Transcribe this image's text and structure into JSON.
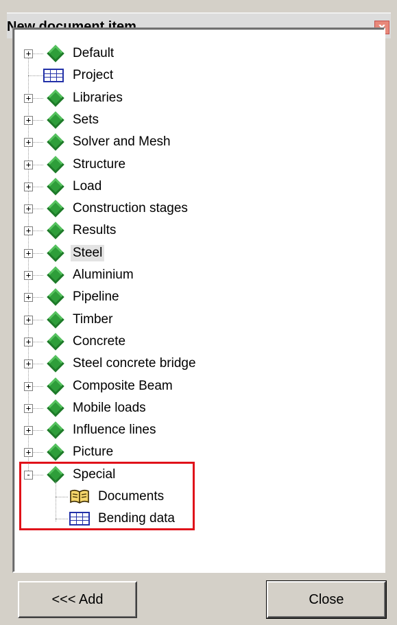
{
  "dialog": {
    "title": "New document item",
    "close_glyph": "x"
  },
  "tree": {
    "items": [
      {
        "label": "Default",
        "icon": "green-diamond-icon",
        "expander": "+"
      },
      {
        "label": "Project",
        "icon": "table-icon",
        "expander": ""
      },
      {
        "label": "Libraries",
        "icon": "green-diamond-icon",
        "expander": "+"
      },
      {
        "label": "Sets",
        "icon": "green-diamond-icon",
        "expander": "+"
      },
      {
        "label": "Solver and Mesh",
        "icon": "green-diamond-icon",
        "expander": "+"
      },
      {
        "label": "Structure",
        "icon": "green-diamond-icon",
        "expander": "+"
      },
      {
        "label": "Load",
        "icon": "green-diamond-icon",
        "expander": "+"
      },
      {
        "label": "Construction stages",
        "icon": "green-diamond-icon",
        "expander": "+"
      },
      {
        "label": "Results",
        "icon": "green-diamond-icon",
        "expander": "+"
      },
      {
        "label": "Steel",
        "icon": "green-diamond-icon",
        "expander": "+",
        "selected": true
      },
      {
        "label": "Aluminium",
        "icon": "green-diamond-icon",
        "expander": "+"
      },
      {
        "label": "Pipeline",
        "icon": "green-diamond-icon",
        "expander": "+"
      },
      {
        "label": "Timber",
        "icon": "green-diamond-icon",
        "expander": "+"
      },
      {
        "label": "Concrete",
        "icon": "green-diamond-icon",
        "expander": "+"
      },
      {
        "label": "Steel concrete bridge",
        "icon": "green-diamond-icon",
        "expander": "+"
      },
      {
        "label": "Composite Beam",
        "icon": "green-diamond-icon",
        "expander": "+"
      },
      {
        "label": "Mobile loads",
        "icon": "green-diamond-icon",
        "expander": "+"
      },
      {
        "label": "Influence lines",
        "icon": "green-diamond-icon",
        "expander": "+"
      },
      {
        "label": "Picture",
        "icon": "green-diamond-icon",
        "expander": "+"
      },
      {
        "label": "Special",
        "icon": "green-diamond-icon",
        "expander": "-"
      }
    ],
    "special_children": [
      {
        "label": "Documents",
        "icon": "book-icon"
      },
      {
        "label": "Bending data",
        "icon": "table-icon"
      }
    ]
  },
  "buttons": {
    "add_label": "<<< Add",
    "close_label": "Close"
  },
  "colors": {
    "highlight": "#e0121a",
    "diamond": "#2e9e3a",
    "table_icon": "#2231a8"
  }
}
